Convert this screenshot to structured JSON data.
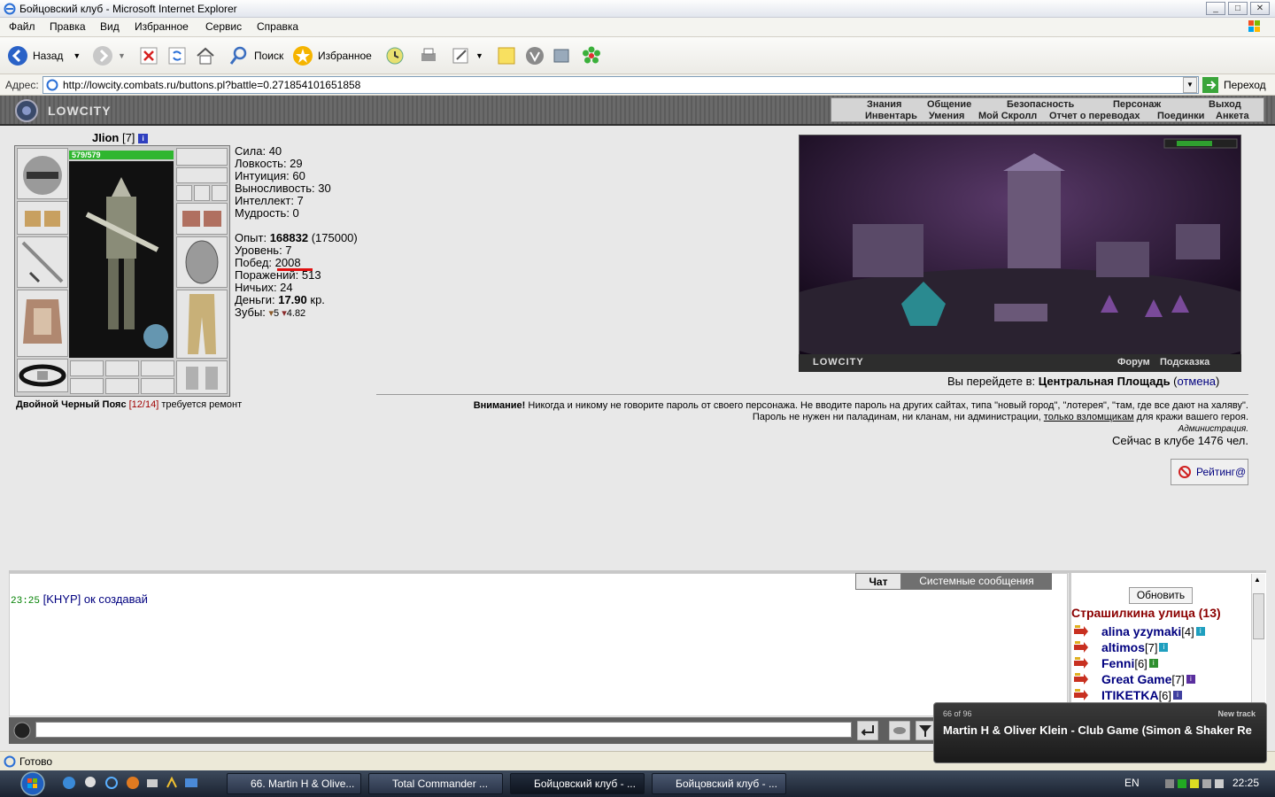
{
  "window": {
    "title": "Бойцовский клуб - Microsoft Internet Explorer",
    "controls": [
      "_",
      "□",
      "✕"
    ]
  },
  "menu": [
    "Файл",
    "Правка",
    "Вид",
    "Избранное",
    "Сервис",
    "Справка"
  ],
  "toolbar": {
    "back_label": "Назад",
    "search_label": "Поиск",
    "favorites_label": "Избранное"
  },
  "address": {
    "label": "Адрес:",
    "url": "http://lowcity.combats.ru/buttons.pl?battle=0.271854101651858",
    "go_label": "Переход"
  },
  "game_nav": {
    "logo": "LOWCITY",
    "row1": [
      "Знания",
      "Общение",
      "Безопасность",
      "Персонаж",
      "Выход"
    ],
    "row2": [
      "Инвентарь",
      "Умения",
      "Мой Скролл",
      "Отчет о переводах",
      "Поединки",
      "Анкета"
    ]
  },
  "character": {
    "name": "JIion",
    "level": "[7]",
    "hp": "579/579"
  },
  "stats": {
    "strength": "Сила: 40",
    "agility": "Ловкость: 29",
    "intuition": "Интуиция: 60",
    "endurance": "Выносливость: 30",
    "intellect": "Интеллект: 7",
    "wisdom": "Мудрость: 0",
    "exp_label": "Опыт: ",
    "exp_value": "168832",
    "exp_next": " (175000)",
    "level_line": "Уровень: 7",
    "wins_label": "Побед: ",
    "wins_value": "2008",
    "losses": "Поражений: 513",
    "draws": "Ничьих: 24",
    "money_label": "Деньги: ",
    "money_value": "17.90",
    "money_unit": " кр.",
    "teeth_label": "Зубы: ",
    "teeth_a": "5",
    "teeth_b": "4.82"
  },
  "belt": {
    "name": "Двойной Черный Пояс",
    "durability": "[12/14]",
    "note": "требуется ремонт"
  },
  "scene": {
    "logo": "LOWCITY",
    "forum": "Форум",
    "hint": "Подсказка"
  },
  "goto": {
    "prefix": "Вы перейдете в: ",
    "place": "Центральная Площадь",
    "cancel": "отмена"
  },
  "warning": {
    "bold": "Внимание!",
    "line1": " Никогда и никому не говорите пароль от своего персонажа. Не вводите пароль на других сайтах, типа \"новый город\", \"лотерея\", \"там, где все дают на халяву\".",
    "line2a": "Пароль не нужен ни паладинам, ни кланам, ни администрации, ",
    "line2u": "только взломщикам",
    "line2b": " для кражи вашего героя.",
    "sign": "Администрация."
  },
  "online": "Сейчас в клубе 1476 чел.",
  "rating_label": "Рейтинг@",
  "chat": {
    "tabs": [
      "Чат",
      "Системные сообщения"
    ],
    "time": "23:25",
    "who": "[KHYP]",
    "msg": "ок создавай"
  },
  "room": {
    "refresh_label": "Обновить",
    "name": "Страшилкина улица (13)",
    "players": [
      {
        "name": "alina yzymaki",
        "level": "[4]",
        "badge_color": "#1f9fbf"
      },
      {
        "name": "altimos",
        "level": "[7]",
        "badge_color": "#1f9fbf"
      },
      {
        "name": "Fenni",
        "level": "[6]",
        "badge_color": "#2f8f2f"
      },
      {
        "name": "Great Game",
        "level": "[7]",
        "badge_color": "#5a2f9f"
      },
      {
        "name": "ITIKETKA",
        "level": "[6]",
        "badge_color": "#3f3f9f"
      }
    ]
  },
  "status": "Готово",
  "notify": {
    "count": "66 of 96",
    "new_track": "New track",
    "track": "Martin H & Oliver Klein - Club Game (Simon & Shaker Re"
  },
  "taskbar": {
    "tasks": [
      "66. Martin H & Olive...",
      "Total Commander ...",
      "Бойцовский клуб - ...",
      "Бойцовский клуб - ..."
    ],
    "lang": "EN",
    "clock": "22:25"
  }
}
